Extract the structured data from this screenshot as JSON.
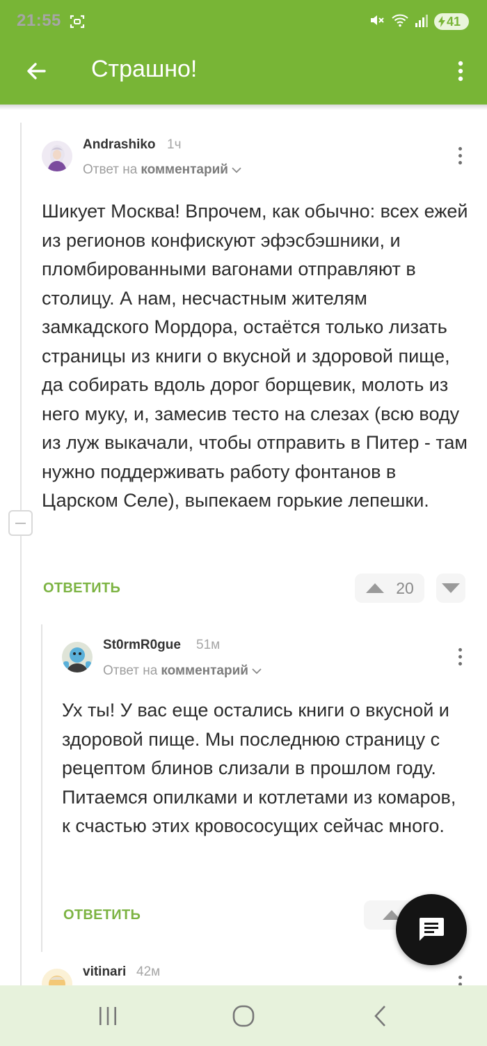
{
  "status_bar": {
    "time": "21:55",
    "battery": "41",
    "icons": [
      "screenshot-icon",
      "mute-icon",
      "wifi-icon",
      "signal-icon",
      "battery-charging-icon"
    ]
  },
  "app_bar": {
    "title": "Страшно!",
    "background": "#78b536"
  },
  "comments": [
    {
      "author": "Andrashiko",
      "time": "1ч",
      "reply_prefix": "Ответ на",
      "reply_target": "комментарий",
      "text": "Шикует Москва! Впрочем, как обычно: всех ежей из регионов конфискуют эфэсбэшники, и пломбированными вагонами отправляют в столицу. А нам, несчастным жителям замкадского Мордора, остаётся только лизать страницы из книги о вкусной и здоровой пище, да собирать вдоль дорог борщевик, молоть из него муку, и, замесив тесто на слезах (всю воду из луж выкачали, чтобы отправить в Питер - там нужно поддерживать работу фонтанов в Царском Селе), выпекаем горькие лепешки.",
      "reply_label": "ОТВЕТИТЬ",
      "rating": "20"
    },
    {
      "author": "St0rmR0gue",
      "time": "51м",
      "reply_prefix": "Ответ на",
      "reply_target": "комментарий",
      "text": "Ух ты! У вас еще остались книги о вкусной и здоровой пище. Мы последнюю страницу с рецептом блинов слизали в прошлом году. Питаемся опилками и котлетами из комаров, к счастью этих кровососущих сейчас много.",
      "reply_label": "ОТВЕТИТЬ"
    },
    {
      "author": "vitinari",
      "time": "42м"
    }
  ],
  "colors": {
    "accent": "#7cb342",
    "nav_background": "#e7f2dc",
    "fab": "#141414"
  }
}
